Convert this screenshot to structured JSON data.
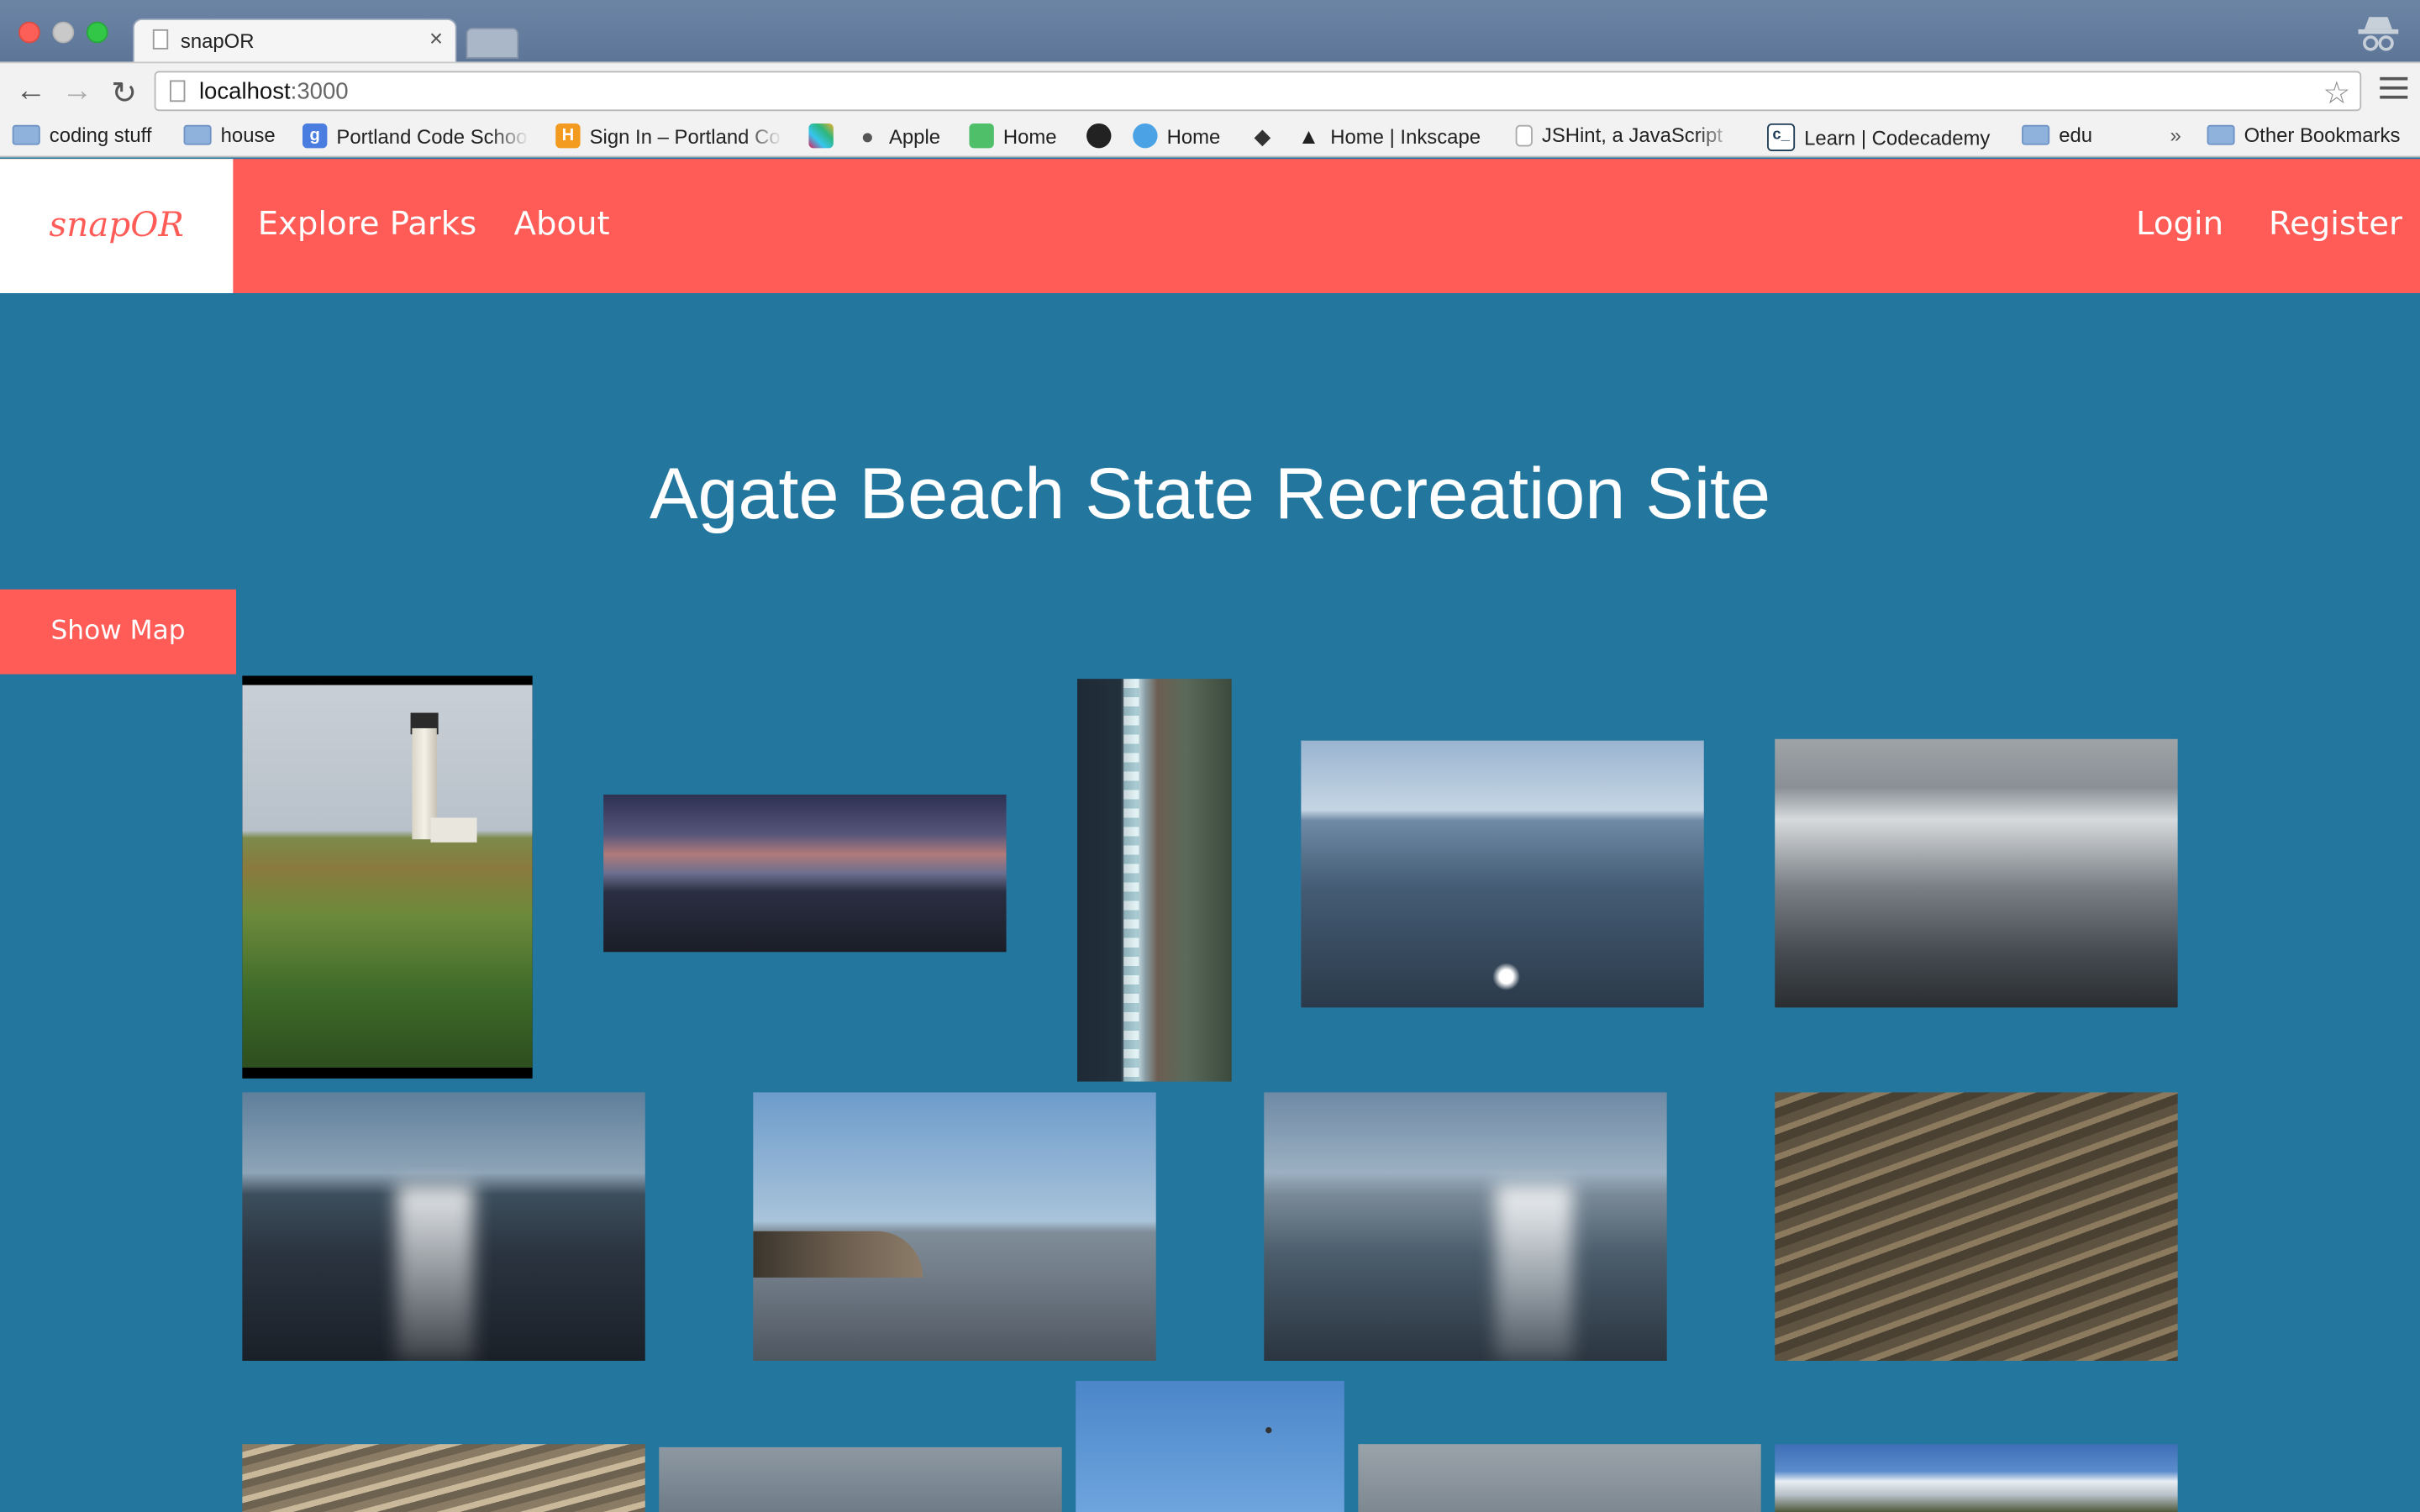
{
  "browser": {
    "tab_title": "snapOR",
    "tab_close": "×",
    "url_host": "localhost",
    "url_port": ":3000",
    "back_icon": "←",
    "forward_icon": "→",
    "reload_icon": "↻",
    "star_icon": "☆",
    "bookmarks_overflow": "»",
    "bookmarks": [
      {
        "label": "coding stuff",
        "icon": "folder-icon"
      },
      {
        "label": "house",
        "icon": "folder-icon"
      },
      {
        "label": "Portland Code Schoo",
        "icon": "google-icon"
      },
      {
        "label": "Sign In – Portland Co",
        "icon": "h-icon"
      },
      {
        "label": "",
        "icon": "slack-icon"
      },
      {
        "label": "Apple",
        "icon": "apple-icon"
      },
      {
        "label": "Home",
        "icon": "feedly-icon"
      },
      {
        "label": "",
        "icon": "github-icon"
      },
      {
        "label": "Home",
        "icon": "twitter-icon"
      },
      {
        "label": "",
        "icon": "gem-icon"
      },
      {
        "label": "Home | Inkscape",
        "icon": "inkscape-icon"
      },
      {
        "label": "JSHint, a JavaScript",
        "icon": "page-icon"
      },
      {
        "label": "Learn | Codecademy",
        "icon": "codecademy-icon"
      },
      {
        "label": "edu",
        "icon": "folder-icon"
      },
      {
        "label": "Other Bookmarks",
        "icon": "folder-icon"
      }
    ]
  },
  "site": {
    "brand": "snapOR",
    "nav_left": [
      "Explore Parks",
      "About"
    ],
    "nav_right": [
      "Login",
      "Register"
    ],
    "accent_color": "#ff5c58",
    "background_color": "#23769e"
  },
  "page": {
    "title": "Agate Beach State Recreation Site",
    "show_map_button": "Show Map"
  }
}
